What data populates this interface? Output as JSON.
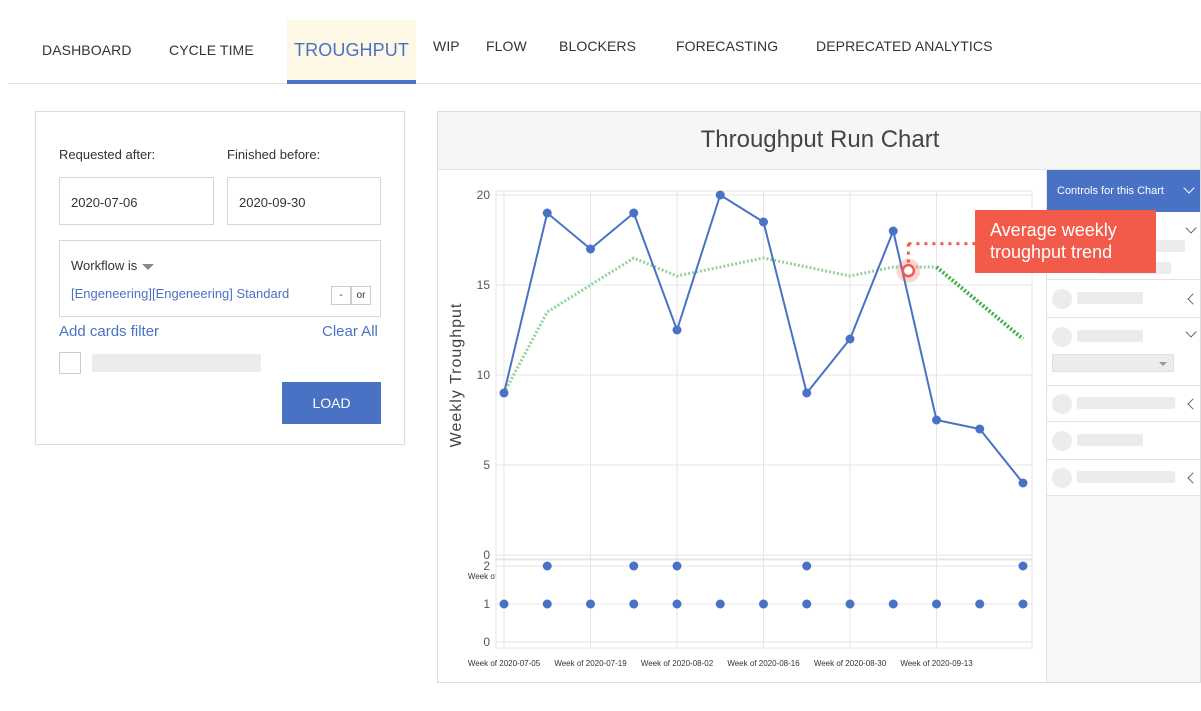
{
  "tabs": [
    {
      "label": "DASHBOARD"
    },
    {
      "label": "CYCLE TIME"
    },
    {
      "label": "TROUGHPUT"
    },
    {
      "label": "WIP"
    },
    {
      "label": "FLOW"
    },
    {
      "label": "BLOCKERS"
    },
    {
      "label": "FORECASTING"
    },
    {
      "label": "DEPRECATED ANALYTICS"
    }
  ],
  "filter": {
    "requested_after_label": "Requested after:",
    "requested_after_value": "2020-07-06",
    "finished_before_label": "Finished before:",
    "finished_before_value": "2020-09-30",
    "workflow_label": "Workflow is",
    "workflow_value": "[Engeneering][Engeneering] Standard",
    "minus_label": "-",
    "or_label": "or",
    "add_filter_label": "Add cards filter",
    "clear_all_label": "Clear All",
    "load_label": "LOAD"
  },
  "controls": {
    "header_label": "Controls for this Chart"
  },
  "annotation": {
    "line1": "Average weekly",
    "line2": "troughput trend"
  },
  "colors": {
    "accent": "#4a72c4",
    "trend": "#8fd49a",
    "trend_strong": "#3cb043",
    "callout": "#f25a4a"
  },
  "chart_data": [
    {
      "type": "line",
      "title": "Throughput Run Chart",
      "ylabel": "Weekly Troughput",
      "xlabel": "",
      "ylim": [
        0,
        20
      ],
      "yticks": [
        0,
        5,
        10,
        15,
        20
      ],
      "x_tick_labels": [
        "Week of 2020-07-05",
        "Week of 2020-07-19",
        "Week of 2020-08-02",
        "Week of 2020-08-16",
        "Week of 2020-08-30",
        "Week of 2020-09-13"
      ],
      "series": [
        {
          "values": [
            9,
            19,
            17,
            19,
            12.5,
            20,
            18.5,
            9,
            12,
            18,
            7.5,
            7,
            4
          ]
        },
        {
          "values": [
            9,
            13.5,
            15,
            16.5,
            15.5,
            16,
            16.5,
            16,
            15.5,
            16,
            16,
            14,
            12
          ]
        }
      ]
    },
    {
      "type": "scatter",
      "ylim": [
        0,
        2
      ],
      "yticks": [
        0,
        1,
        2
      ],
      "x_tick_labels": [
        "Week of 2020-07-05",
        "Week of 2020-07-19",
        "Week of 2020-08-02",
        "Week of 2020-08-16",
        "Week of 2020-08-30",
        "Week of 2020-09-13"
      ],
      "points": [
        [
          0,
          1
        ],
        [
          1,
          1
        ],
        [
          1,
          2
        ],
        [
          2,
          1
        ],
        [
          3,
          1
        ],
        [
          3,
          2
        ],
        [
          4,
          1
        ],
        [
          4,
          2
        ],
        [
          5,
          1
        ],
        [
          6,
          1
        ],
        [
          7,
          1
        ],
        [
          7,
          2
        ],
        [
          8,
          1
        ],
        [
          9,
          1
        ],
        [
          10,
          1
        ],
        [
          11,
          1
        ],
        [
          12,
          1
        ],
        [
          12,
          2
        ]
      ]
    }
  ]
}
